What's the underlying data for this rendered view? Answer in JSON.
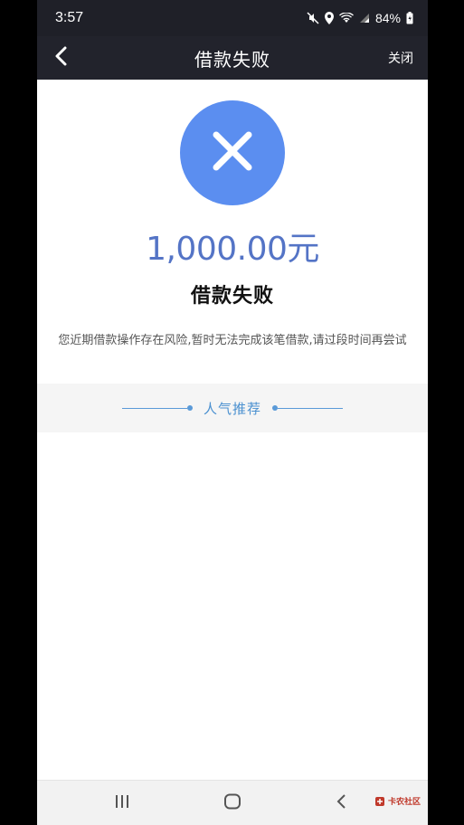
{
  "status_bar": {
    "time": "3:57",
    "battery": "84%",
    "icons": [
      "mute-icon",
      "location-icon",
      "wifi-icon",
      "signal-icon",
      "battery-icon"
    ]
  },
  "nav": {
    "title": "借款失败",
    "close_label": "关闭",
    "back_icon": "chevron-left-icon"
  },
  "result": {
    "icon": "close-x-icon",
    "icon_color": "#5b8ef0",
    "amount": "1,000.00元",
    "amount_color": "#5474c6",
    "title": "借款失败",
    "message": "您近期借款操作存在风险,暂时无法完成该笔借款,请过段时间再尝试"
  },
  "recommend": {
    "label": "人气推荐",
    "accent": "#4a90d0"
  },
  "system_nav": {
    "buttons": [
      "recent-apps-icon",
      "home-icon",
      "back-icon"
    ]
  },
  "watermark": {
    "text": "卡农社区"
  }
}
